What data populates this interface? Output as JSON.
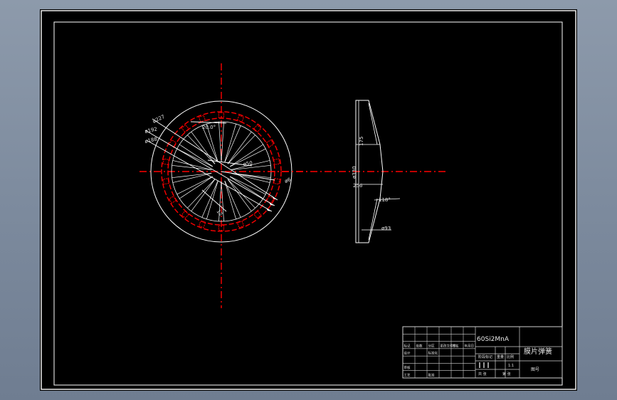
{
  "drawing": {
    "colors": {
      "background": "#000000",
      "line": "#ffffff",
      "centerline": "#ff0000",
      "dimension": "#ffffff",
      "text": "#e6e6e6"
    },
    "front_view": {
      "dims": {
        "d227": "ø227",
        "d192": "ø192",
        "d188": "ø188",
        "angle_20": "20.0°",
        "d50": "ø50",
        "d6": "ø6",
        "r12": "12"
      }
    },
    "side_view": {
      "dims": {
        "d175": "175",
        "d330": "ø330",
        "d256": "256",
        "angle_118": "118°",
        "d93": "ø93"
      }
    },
    "title_block": {
      "material": "60Si2MnA",
      "part_name": "膜片弹簧",
      "scale": "1:1",
      "drawing_no": "图号",
      "left_cells": [
        [
          "",
          "",
          "",
          "",
          "",
          ""
        ],
        [
          "",
          "",
          "",
          "",
          "",
          ""
        ],
        [
          "标记",
          "处数",
          "分区",
          "更改文件号",
          "签名",
          "年月日"
        ],
        [
          "设计",
          "",
          "标准化",
          "",
          "",
          ""
        ],
        [
          "",
          "",
          "",
          "",
          "",
          ""
        ],
        [
          "审核",
          "",
          "",
          "",
          "",
          ""
        ],
        [
          "工艺",
          "",
          "批准",
          "",
          "",
          ""
        ]
      ],
      "stage_label": "阶段标记",
      "weight_label": "重量",
      "ratio_label": "比例",
      "sheet_total": "共 张",
      "sheet_no": "第 张"
    }
  }
}
